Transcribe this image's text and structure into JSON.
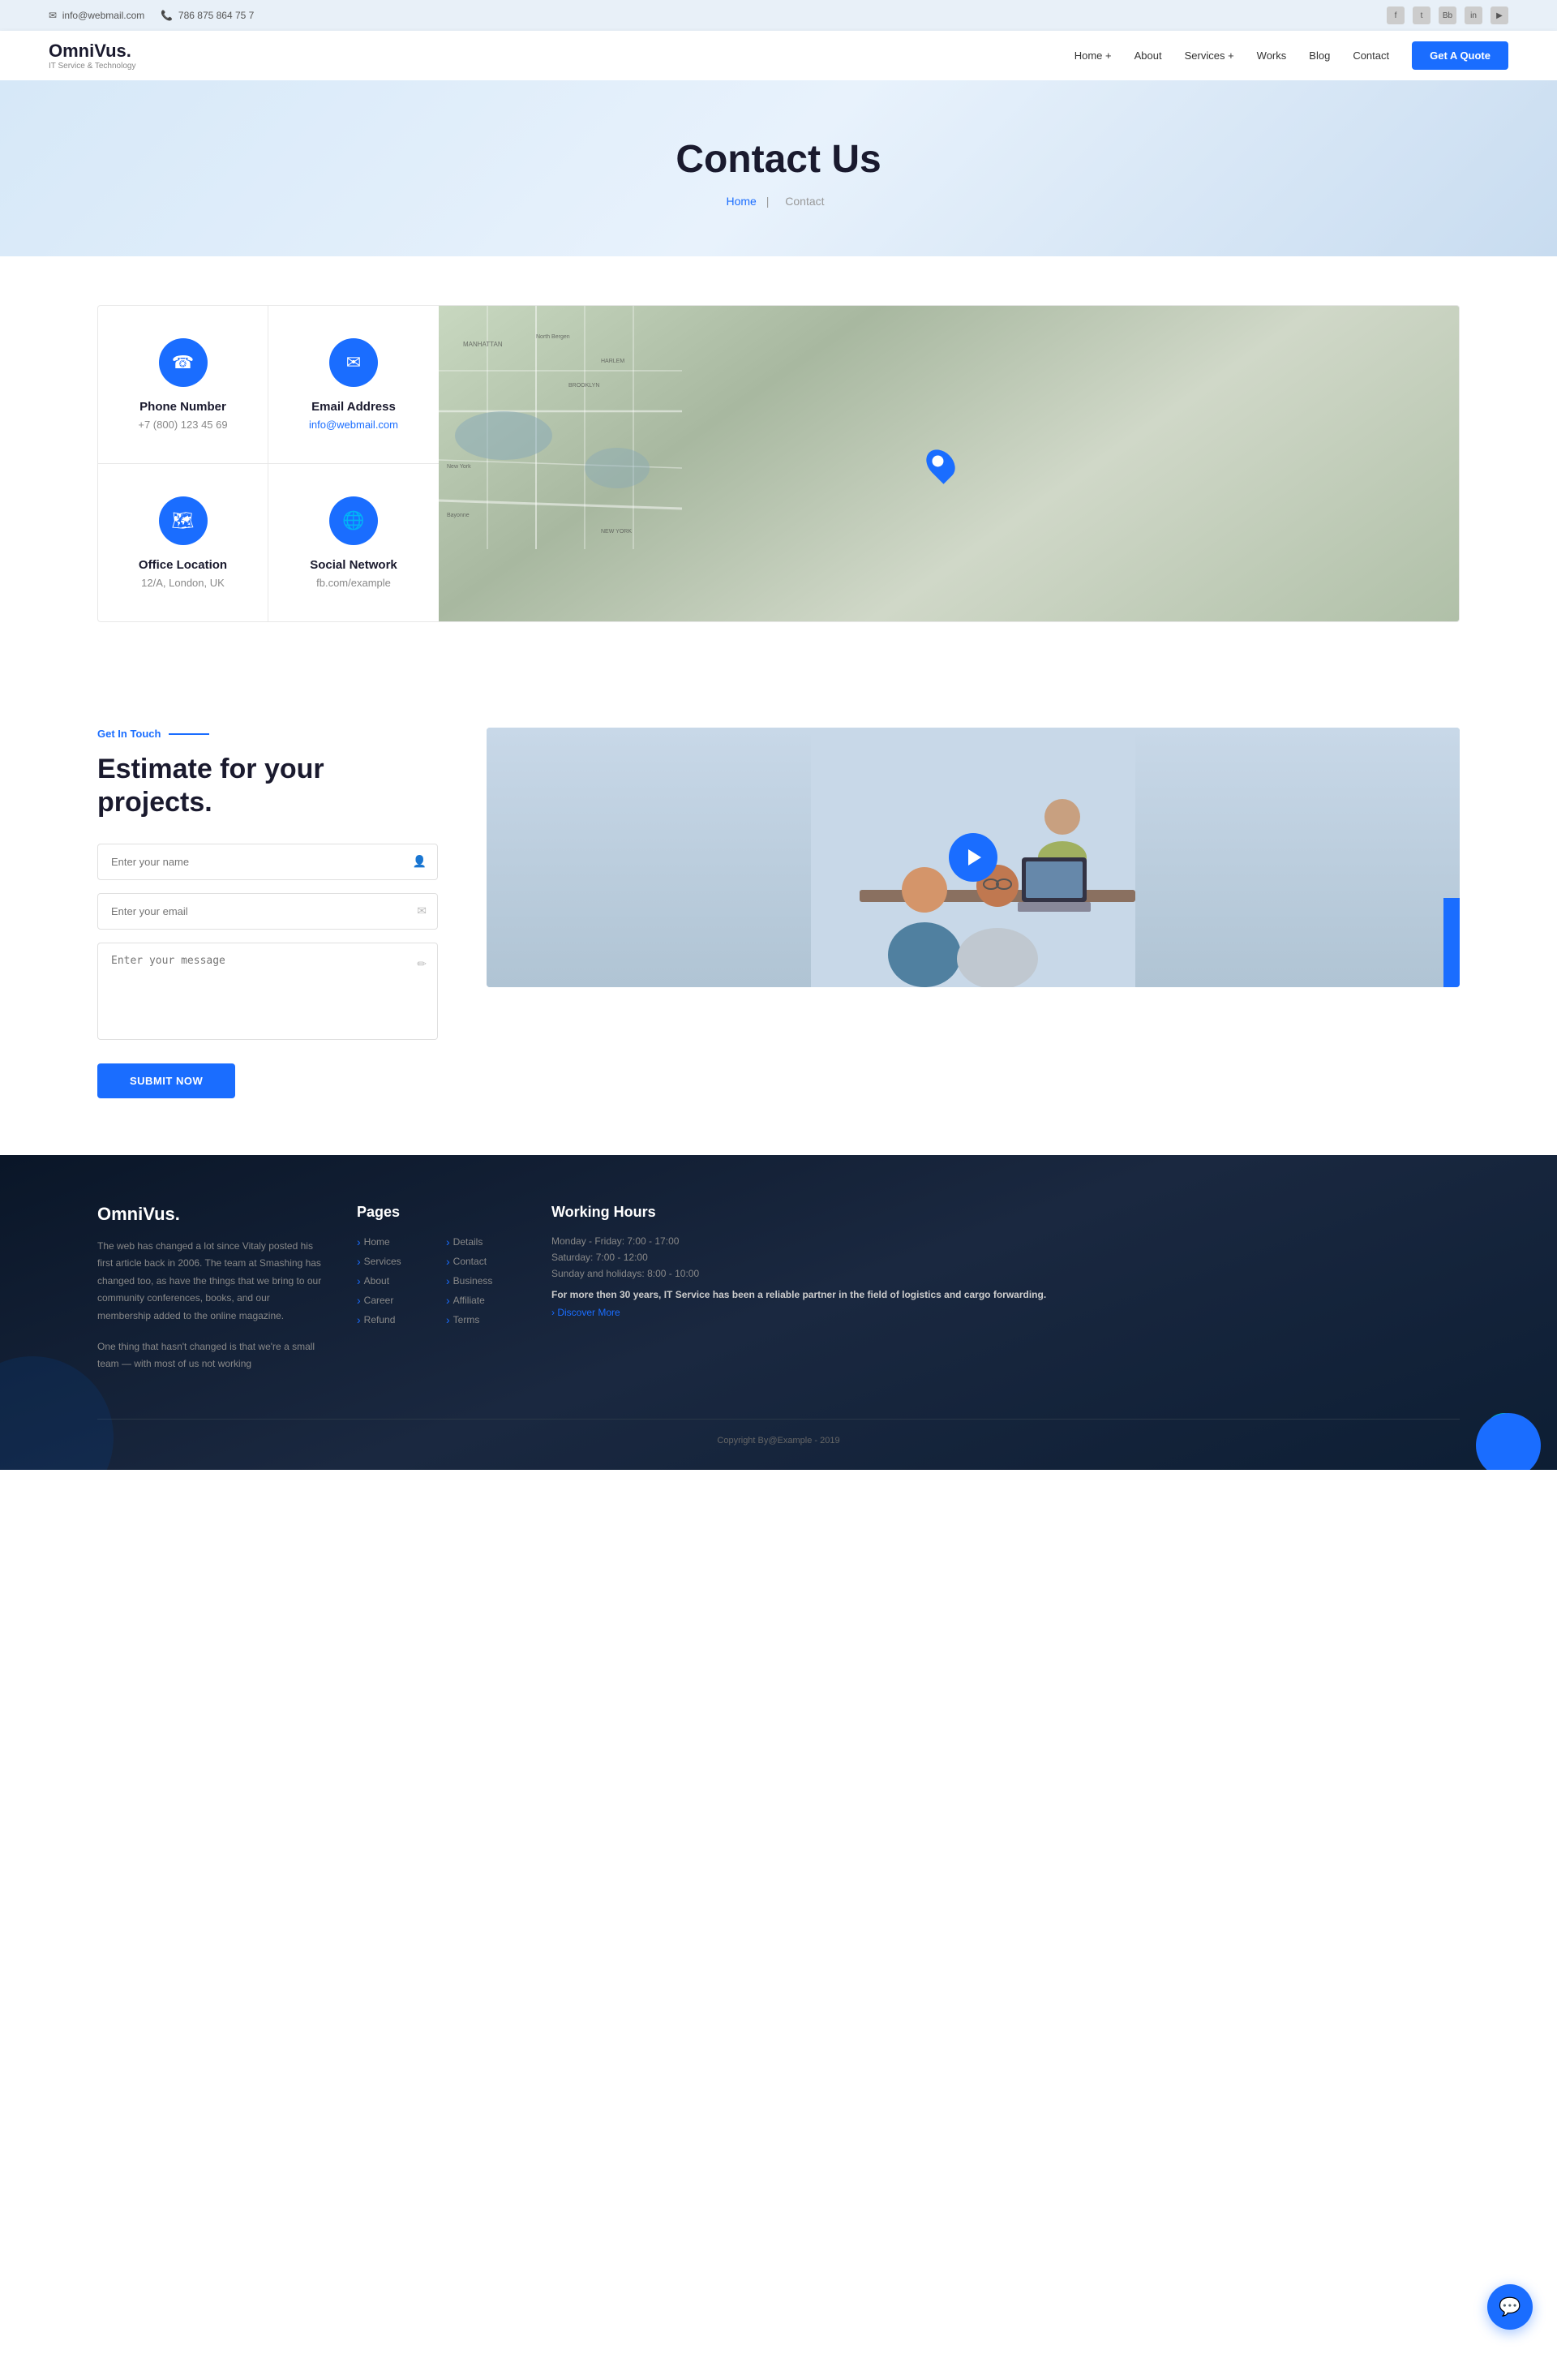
{
  "topbar": {
    "email": "info@webmail.com",
    "phone": "786 875 864 75 7",
    "email_icon": "✉",
    "phone_icon": "📞"
  },
  "navbar": {
    "logo": "OmniVus.",
    "logo_sub": "IT Service & Technology",
    "links": [
      {
        "label": "Home +",
        "id": "home"
      },
      {
        "label": "About",
        "id": "about"
      },
      {
        "label": "Services +",
        "id": "services"
      },
      {
        "label": "Works",
        "id": "works"
      },
      {
        "label": "Blog",
        "id": "blog"
      },
      {
        "label": "Contact",
        "id": "contact"
      }
    ],
    "cta_button": "Get A Quote"
  },
  "hero": {
    "title": "Contact Us",
    "breadcrumb_home": "Home",
    "breadcrumb_separator": "|",
    "breadcrumb_current": "Contact"
  },
  "contact_cards": [
    {
      "icon": "☎",
      "title": "Phone Number",
      "value": "+7 (800) 123 45 69"
    },
    {
      "icon": "✉",
      "title": "Email Address",
      "value": "info@webmail.com",
      "is_link": true
    },
    {
      "icon": "🗺",
      "title": "Office Location",
      "value": "12/A, London, UK"
    },
    {
      "icon": "🌐",
      "title": "Social Network",
      "value": "fb.com/example"
    }
  ],
  "estimate": {
    "tag": "Get In Touch",
    "title": "Estimate for your projects.",
    "form": {
      "name_placeholder": "Enter your name",
      "email_placeholder": "Enter your email",
      "message_placeholder": "Enter your message",
      "submit_label": "Submit Now"
    }
  },
  "footer": {
    "brand": "OmniVus.",
    "description1": "The web has changed a lot since Vitaly posted his first article back in 2006. The team at Smashing has changed too, as have the things that we bring to our community conferences, books, and our membership added to the online magazine.",
    "description2": "One thing that hasn't changed is that we're a small team — with most of us not working",
    "pages_title": "Pages",
    "pages": [
      {
        "label": "Home",
        "col": 1
      },
      {
        "label": "Details",
        "col": 2
      },
      {
        "label": "Services",
        "col": 1
      },
      {
        "label": "Contact",
        "col": 2
      },
      {
        "label": "About",
        "col": 1
      },
      {
        "label": "Business",
        "col": 2
      },
      {
        "label": "Career",
        "col": 1
      },
      {
        "label": "Affiliate",
        "col": 2
      },
      {
        "label": "Refund",
        "col": 1
      },
      {
        "label": "Terms",
        "col": 1
      }
    ],
    "hours_title": "Working Hours",
    "hours": [
      "Monday - Friday: 7:00 - 17:00",
      "Saturday: 7:00 - 12:00",
      "Sunday and holidays: 8:00 - 10:00"
    ],
    "hours_note": "For more then 30 years, IT Service has been a reliable partner in the field of logistics and cargo forwarding.",
    "discover_link": "› Discover More",
    "copyright": "Copyright By@Example - 2019"
  }
}
